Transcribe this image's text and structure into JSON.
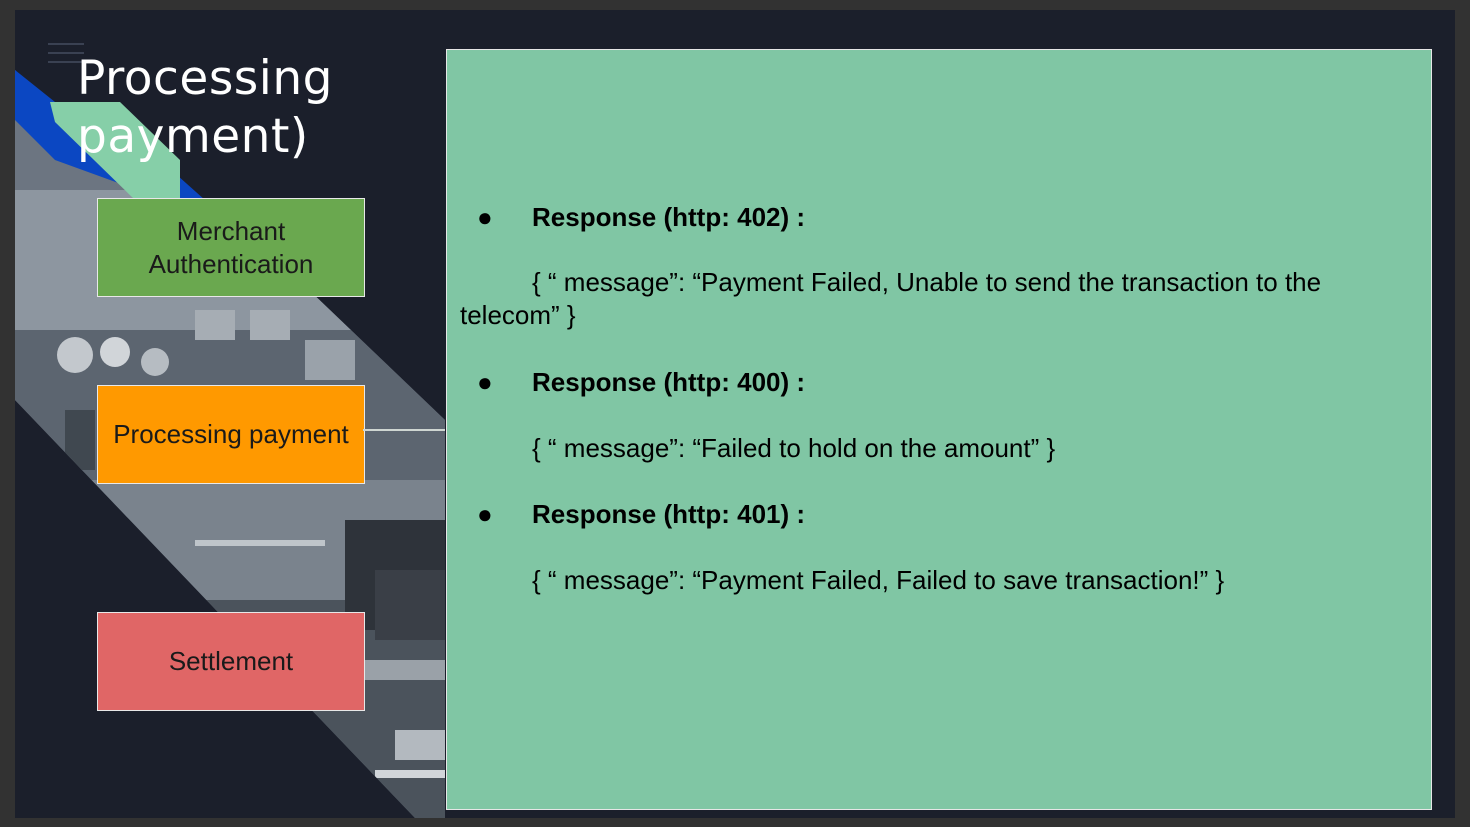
{
  "slide": {
    "title": "Processing payment)",
    "steps": {
      "merchant": "Merchant Authentication",
      "processing": "Processing payment",
      "settlement": "Settlement"
    },
    "colors": {
      "background": "#1b1f2b",
      "panel": "#80c6a4",
      "merchant": "#6aa84f",
      "processing": "#ff9900",
      "settlement": "#e06666",
      "accent_blue": "#0b47c2",
      "accent_green": "#86cfa8"
    },
    "responses": [
      {
        "bullet": "●",
        "label": "Response (http: 402) :",
        "message": "{ “ message”:  “Payment Failed, Unable to send the transaction to the telecom” }"
      },
      {
        "bullet": "●",
        "label": "Response (http: 400) :",
        "message": "{ “ message”:  “Failed to hold on the amount” }"
      },
      {
        "bullet": "●",
        "label": "Response (http: 401) :",
        "message": "{ “ message”:  “Payment Failed, Failed to save transaction!” }"
      }
    ]
  }
}
